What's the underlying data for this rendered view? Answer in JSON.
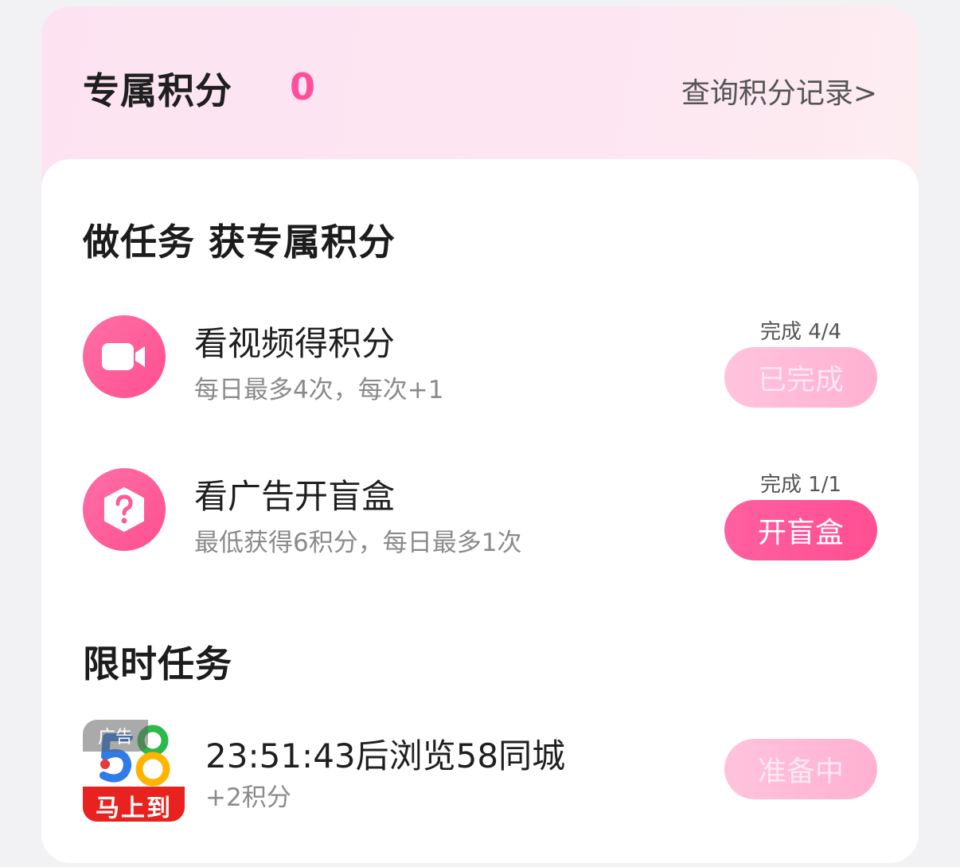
{
  "header": {
    "title": "专属积分",
    "points": "0",
    "history_link": "查询积分记录>"
  },
  "section_tasks": {
    "title": "做任务 获专属积分",
    "tasks": [
      {
        "icon": "video-camera-icon",
        "title": "看视频得积分",
        "desc": "每日最多4次，每次+1",
        "progress": "完成 4/4",
        "button": "已完成"
      },
      {
        "icon": "question-mark-icon",
        "title": "看广告开盲盒",
        "desc": "最低获得6积分，每日最多1次",
        "progress": "完成 1/1",
        "button": "开盲盒"
      }
    ]
  },
  "section_limited": {
    "title": "限时任务",
    "tasks": [
      {
        "ad_badge": "广告",
        "logo_number": "58",
        "logo_slogan": "马上到",
        "title": "23:51:43后浏览58同城",
        "desc": "+2积分",
        "button": "准备中"
      }
    ]
  },
  "colors": {
    "accent": "#ff4f93",
    "accent_light": "#ffb1d2",
    "header_bg": "#fde3f1"
  }
}
